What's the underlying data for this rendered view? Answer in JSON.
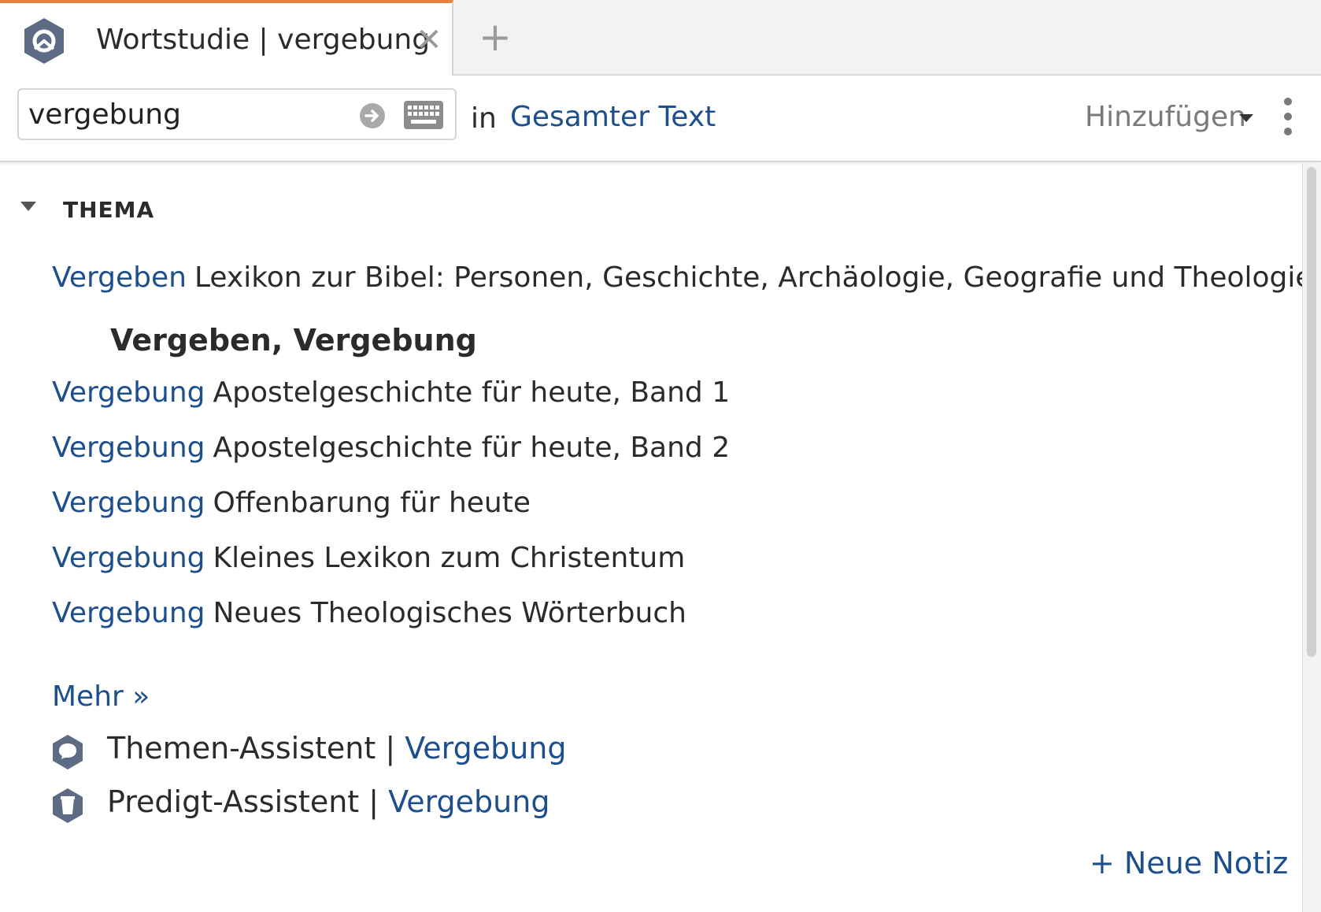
{
  "tab": {
    "title": "Wortstudie | vergebung",
    "close_glyph": "✕",
    "add_glyph": "+",
    "icon": "logos-guide-icon"
  },
  "toolbar": {
    "search_value": "vergebung",
    "in_label": "in",
    "scope": "Gesamter Text",
    "add_menu": "Hinzufügen"
  },
  "section": {
    "title": "THEMA"
  },
  "results": [
    {
      "term": "Vergeben",
      "source": "Lexikon zur Bibel: Personen, Geschichte, Archäologie, Geografie und Theologie…"
    },
    {
      "term": "Vergebung",
      "source": "Apostelgeschichte für heute, Band 1"
    },
    {
      "term": "Vergebung",
      "source": "Apostelgeschichte für heute, Band 2"
    },
    {
      "term": "Vergebung",
      "source": "Offenbarung für heute"
    },
    {
      "term": "Vergebung",
      "source": "Kleines Lexikon zum Christentum"
    },
    {
      "term": "Vergebung",
      "source": "Neues Theologisches Wörterbuch"
    }
  ],
  "subheading": "Vergeben, Vergebung",
  "more_link": "Mehr »",
  "assistants": [
    {
      "label": "Themen-Assistent | ",
      "link": "Vergebung",
      "icon": "topic-guide-icon"
    },
    {
      "label": "Predigt-Assistent | ",
      "link": "Vergebung",
      "icon": "sermon-guide-icon"
    }
  ],
  "new_note": "+ Neue Notiz",
  "colors": {
    "accent_tab": "#e8813b",
    "link": "#1d4f8c",
    "icon": "#5d6b85"
  }
}
